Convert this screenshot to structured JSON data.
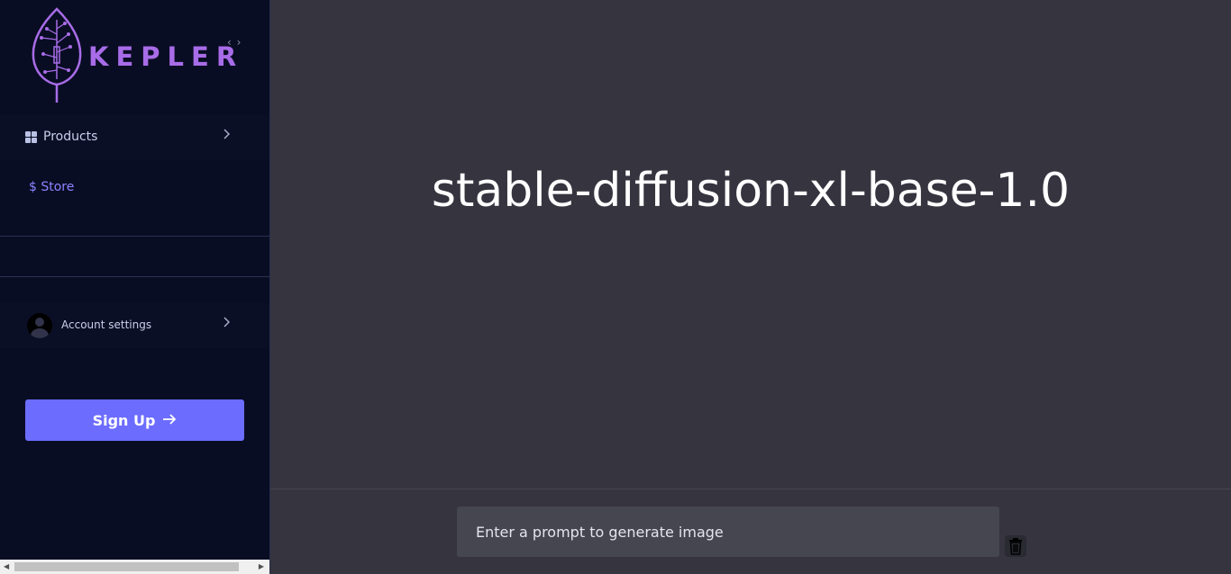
{
  "sidebar": {
    "logo_text": "KEPLER",
    "collapse_toggle": "‹ ›",
    "nav": {
      "products_label": "Products",
      "store_label": "$ Store"
    },
    "account_label": "Account settings",
    "signup_label": "Sign Up",
    "signup_arrow": "→"
  },
  "main": {
    "title": "stable-diffusion-xl-base-1.0",
    "prompt_placeholder": "Enter a prompt to generate image",
    "prompt_value": ""
  },
  "colors": {
    "sidebar_bg": "#090d24",
    "main_bg": "#35343f",
    "accent": "#6c6cff",
    "logo": "#a86ce8",
    "store_link": "#8b84ff"
  },
  "icons": [
    "leaf-circuit-logo-icon",
    "grid-icon",
    "chevron-right-icon",
    "avatar-icon",
    "arrow-right-icon",
    "trash-icon"
  ]
}
